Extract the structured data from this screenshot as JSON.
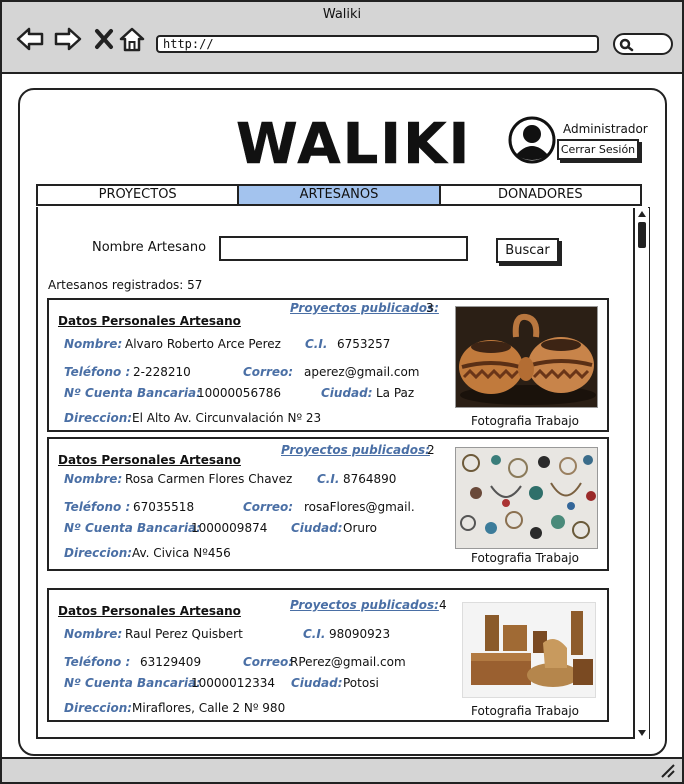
{
  "window": {
    "title": "Waliki",
    "url": "http://"
  },
  "header": {
    "logo": "WALIKI",
    "user_label": "Administrador",
    "logout_label": "Cerrar Sesión"
  },
  "tabs": [
    {
      "label": "PROYECTOS",
      "active": false
    },
    {
      "label": "ARTESANOS",
      "active": true
    },
    {
      "label": "DONADORES",
      "active": false
    }
  ],
  "search": {
    "label": "Nombre Artesano",
    "value": "",
    "button_label": "Buscar"
  },
  "registered_count": "Artesanos registrados: 57",
  "labels": {
    "section": "Datos Personales Artesano",
    "projects": "Proyectos publicados:",
    "name": "Nombre:",
    "ci": "C.I.",
    "phone": "Teléfono :",
    "email": "Correo:",
    "account": "Nº Cuenta Bancaria:",
    "city": "Ciudad:",
    "address": "Direccion:",
    "photo_caption": "Fotografia Trabajo"
  },
  "artisans": [
    {
      "projects": "3",
      "name": "Alvaro Roberto  Arce  Perez",
      "ci": "6753257",
      "phone": "2-228210",
      "email": "aperez@gmail.com",
      "account": "10000056786",
      "city": "La Paz",
      "address": "El Alto Av. Circunvalación Nº 23"
    },
    {
      "projects": "2",
      "name": "Rosa  Carmen  Flores  Chavez",
      "ci": "8764890",
      "phone": "67035518",
      "email": "rosaFlores@gmail.c",
      "account": "1000009874",
      "city": "Oruro",
      "address": "Av. Civica Nº456"
    },
    {
      "projects": "4",
      "name": "Raul   Perez   Quisbert",
      "ci": "98090923",
      "phone": "63129409",
      "email": "RPerez@gmail.com",
      "account": "10000012334",
      "city": "Potosi",
      "address": "Miraflores, Calle 2 Nº 980"
    }
  ],
  "icons": {
    "back": "arrow-left-icon",
    "forward": "arrow-right-icon",
    "stop": "close-icon",
    "home": "home-icon",
    "search": "magnifier-icon",
    "user": "user-avatar-icon"
  },
  "colors": {
    "active_tab": "#a3c3ee",
    "field_label": "#4a6fa5",
    "chrome": "#d5d5d5"
  }
}
